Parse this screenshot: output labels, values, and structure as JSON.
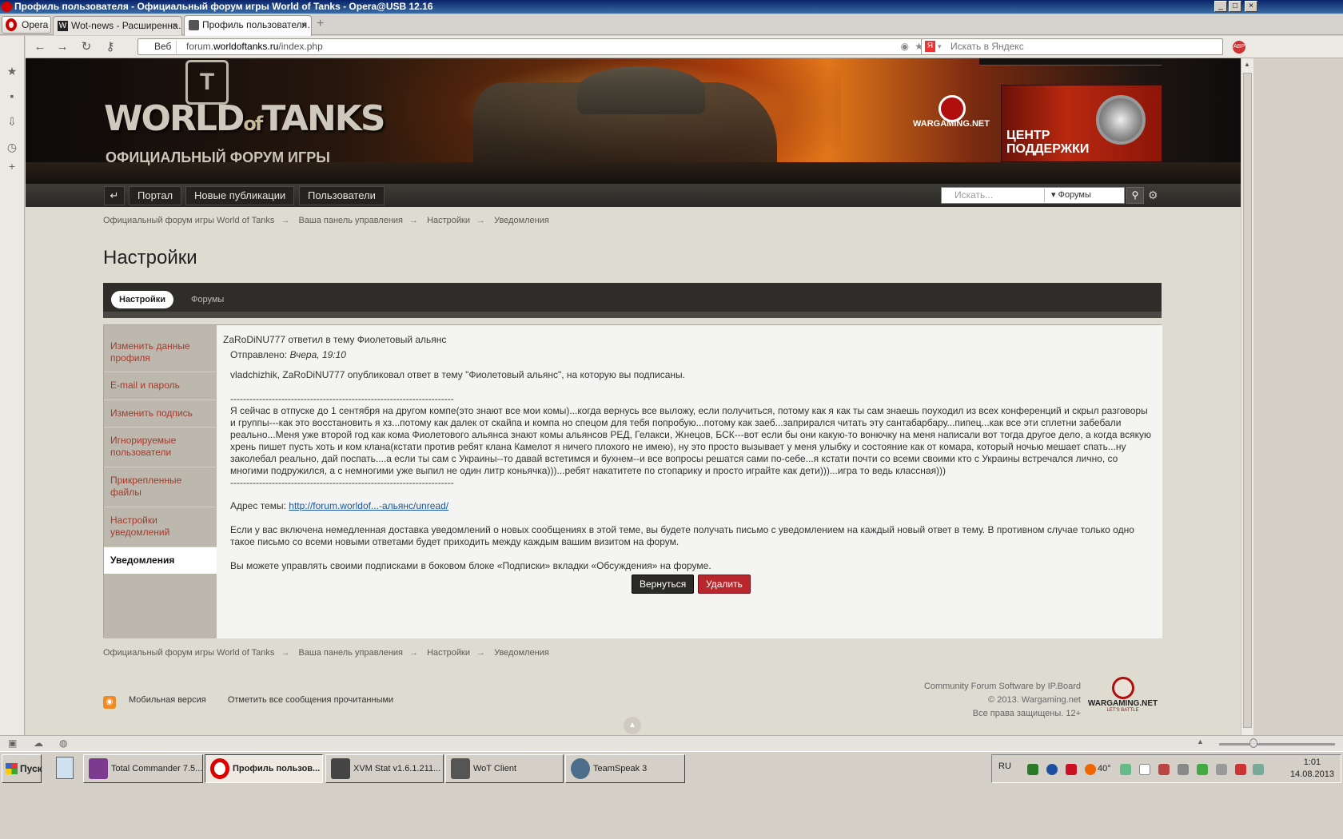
{
  "window": {
    "title": "Профиль пользователя - Официальный форум игры World of Tanks - Opera@USB 12.16"
  },
  "browser": {
    "menu_label": "Opera",
    "tabs": [
      {
        "label": "Wot-news - Расширенна…",
        "active": false
      },
      {
        "label": "Профиль пользователя…",
        "active": true
      }
    ],
    "address": {
      "badge": "Веб",
      "url_prefix": "forum.",
      "url_domain": "worldoftanks.ru",
      "url_path": "/index.php"
    },
    "search_placeholder": "Искать в Яндекс"
  },
  "site": {
    "logo_text": "WORLD",
    "logo_of": "of",
    "logo_tanks": "TANKS",
    "forum_subtitle": "ОФИЦИАЛЬНЫЙ ФОРУМ ИГРЫ",
    "wargaming_label": "WARGAMING.NET",
    "support_label_1": "ЦЕНТР",
    "support_label_2": "ПОДДЕРЖКИ",
    "nav": {
      "home_icon": "enter-arrow-icon",
      "items": [
        "Портал",
        "Новые публикации",
        "Пользователи"
      ]
    },
    "search": {
      "placeholder": "Искать...",
      "scope": "Форумы"
    }
  },
  "breadcrumb": [
    "Официальный форум игры World of Tanks",
    "Ваша панель управления",
    "Настройки",
    "Уведомления"
  ],
  "breadcrumb_sep": "→",
  "page_title": "Настройки",
  "tabs": {
    "active": "Настройки",
    "other": "Форумы"
  },
  "sidebar": [
    {
      "label": "Изменить данные профиля",
      "active": false
    },
    {
      "label": "E-mail и пароль",
      "active": false
    },
    {
      "label": "Изменить подпись",
      "active": false
    },
    {
      "label": "Игнорируемые пользователи",
      "active": false
    },
    {
      "label": "Прикрепленные файлы",
      "active": false
    },
    {
      "label": "Настройки уведомлений",
      "active": false
    },
    {
      "label": "Уведомления",
      "active": true
    }
  ],
  "notification": {
    "title": "ZaRoDiNU777 ответил в тему Фиолетовый альянс",
    "sent_label": "Отправлено:",
    "sent_value": "Вчера, 19:10",
    "intro": "vladchizhik, ZaRoDiNU777 опубликовал ответ в тему \"Фиолетовый альянс\", на которую вы подписаны.",
    "divider": "----------------------------------------------------------------------",
    "body": "Я сейчас в отпуске до 1 сентября на другом компе(это знают все мои комы)...когда вернусь все выложу, если получиться, потому как я как ты сам знаешь поуходил из всех конференций и скрыл разговоры и группы---как это восстановить я хз...потому как далек от скайпа и компа но спецом для тебя попробую...потому как заеб...заприрался читать эту сантабарбару...пипец...как все эти сплетни забебали реально...Меня уже второй год как кома Фиолетового альянса знают комы альянсов РЕД, Гелакси, Жнецов, БСК---вот если бы они какую-то вонючку на меня написали вот тогда другое дело, а когда всякую хрень пишет пусть хоть и ком клана(кстати против ребят клана Камелот я ничего плохого не имею), ну это просто вызывает у меня улыбку и состояние как от комара, который ночью мешает спать...ну заколебал реально, дай поспать....а если ты сам с Украины--то давай встетимся и бухнем--и все вопросы решатся сами по-себе...я кстати почти со всеми своими кто с Украины встречался лично, со многими подружился, а с немногими уже выпил не один литр коньячка)))...ребят накатитете по стопарику и просто играйте как дети)))...игра то ведь классная)))",
    "topic_label": "Адрес темы:",
    "topic_link": "http://forum.worldof...-альянс/unread/",
    "info1": "Если у вас включена немедленная доставка уведомлений о новых сообщениях в этой теме, вы будете получать письмо с уведомлением на каждый новый ответ в тему. В противном случае только одно такое письмо со всеми новыми ответами будет приходить между каждым вашим визитом на форум.",
    "info2": "Вы можете управлять своими подписками в боковом блоке «Подписки» вкладки «Обсуждения» на форуме.",
    "btn_back": "Вернуться",
    "btn_delete": "Удалить"
  },
  "footer": {
    "mobile": "Мобильная версия",
    "mark_read": "Отметить все сообщения прочитанными",
    "copy1": "Community Forum Software by IP.Board",
    "copy2": "© 2013. Wargaming.net",
    "copy3": "Все права защищены. 12+",
    "wg_name": "WARGAMING.NET",
    "wg_slogan": "LET'S BATTLE"
  },
  "taskbar": {
    "start": "Пуск",
    "tasks": [
      {
        "label": "Total Commander 7.5...",
        "active": false
      },
      {
        "label": "Профиль пользов...",
        "active": true
      },
      {
        "label": "XVM Stat v1.6.1.211...",
        "active": false
      },
      {
        "label": "WoT Client",
        "active": false
      },
      {
        "label": "TeamSpeak 3",
        "active": false
      }
    ],
    "lang": "RU",
    "tray_temp": "40°",
    "time": "1:01",
    "date": "14.08.2013"
  },
  "colors": {
    "accent_red": "#b9262b",
    "link_red": "#a63a2e",
    "link_blue": "#1a55a0",
    "nav_dark": "#2f2d29"
  }
}
